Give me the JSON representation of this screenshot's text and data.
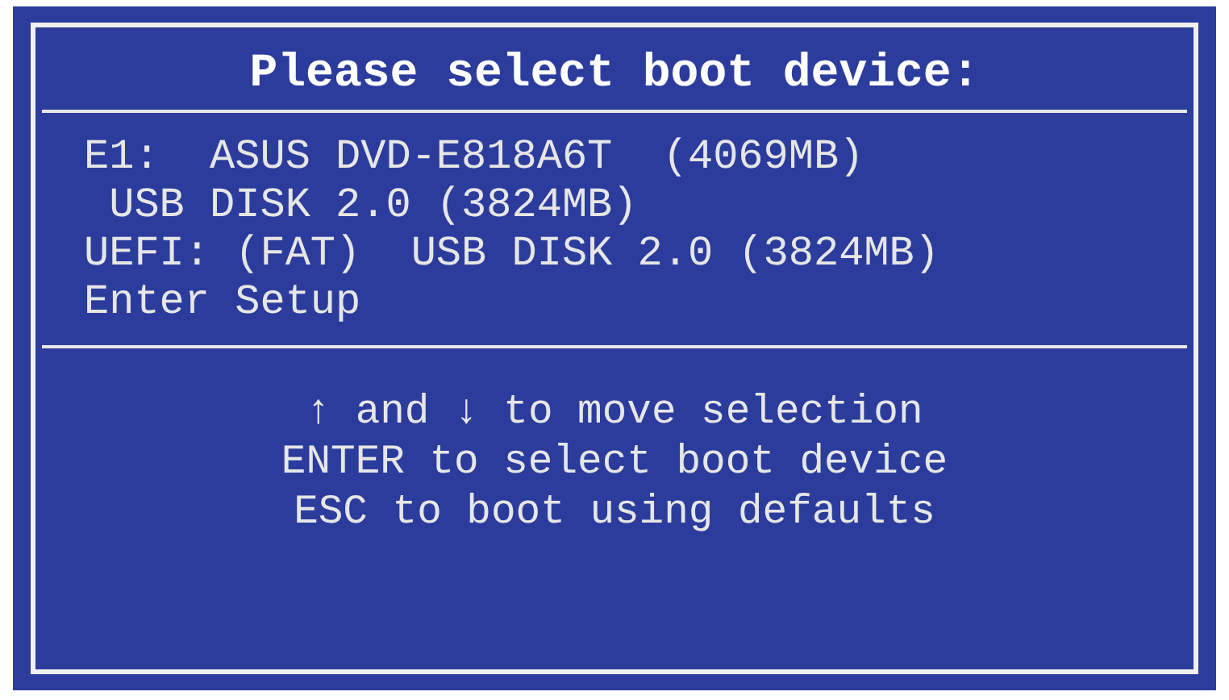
{
  "title": "Please select boot device:",
  "devices": [
    {
      "label": "E1:  ASUS DVD-E818A6T  (4069MB)"
    },
    {
      "label": " USB DISK 2.0 (3824MB)"
    },
    {
      "label": "UEFI: (FAT)  USB DISK 2.0 (3824MB)"
    },
    {
      "label": "Enter Setup"
    }
  ],
  "help": [
    "↑ and ↓ to move selection",
    "ENTER to select boot device",
    "ESC to boot using defaults"
  ]
}
